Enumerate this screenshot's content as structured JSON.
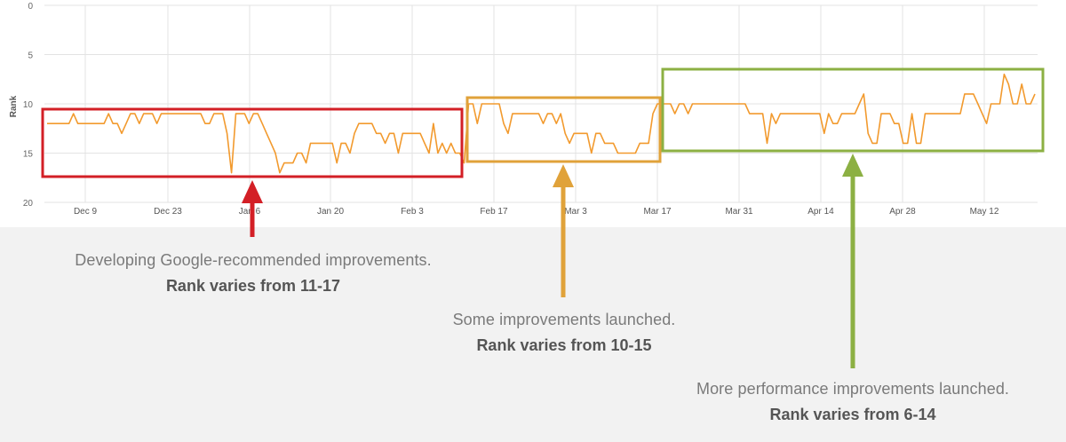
{
  "chart_data": {
    "type": "line",
    "ylabel": "Rank",
    "ylim": [
      0,
      20
    ],
    "y_inverted": true,
    "y_ticks": [
      0,
      5,
      10,
      15,
      20
    ],
    "x_tick_labels": [
      "Dec 9",
      "Dec 23",
      "Jan 6",
      "Jan 20",
      "Feb 3",
      "Feb 17",
      "Mar 3",
      "Mar 17",
      "Mar 31",
      "Apr 14",
      "Apr 28",
      "May 12"
    ],
    "x_range": [
      "Nov 28",
      "May 22"
    ],
    "grid": true,
    "line_color": "#f29a2e",
    "series": [
      {
        "values": [
          12,
          12,
          12,
          12,
          12,
          12,
          11,
          12,
          12,
          12,
          12,
          12,
          12,
          12,
          11,
          12,
          12,
          13,
          12,
          11,
          11,
          12,
          11,
          11,
          11,
          12,
          11,
          11,
          11,
          11,
          11,
          11,
          11,
          11,
          11,
          11,
          12,
          12,
          11,
          11,
          11,
          13,
          17,
          11,
          11,
          11,
          12,
          11,
          11,
          12,
          13,
          14,
          15,
          17,
          16,
          16,
          16,
          15,
          15,
          16,
          14,
          14,
          14,
          14,
          14,
          14,
          16,
          14,
          14,
          15,
          13,
          12,
          12,
          12,
          12,
          13,
          13,
          14,
          13,
          13,
          15,
          13,
          13,
          13,
          13,
          13,
          14,
          15,
          12,
          15,
          14,
          15,
          14,
          15,
          15,
          16,
          10,
          10,
          12,
          10,
          10,
          10,
          10,
          10,
          12,
          13,
          11,
          11,
          11,
          11,
          11,
          11,
          11,
          12,
          11,
          11,
          12,
          11,
          13,
          14,
          13,
          13,
          13,
          13,
          15,
          13,
          13,
          14,
          14,
          14,
          15,
          15,
          15,
          15,
          15,
          14,
          14,
          14,
          11,
          10,
          10,
          10,
          10,
          11,
          10,
          10,
          11,
          10,
          10,
          10,
          10,
          10,
          10,
          10,
          10,
          10,
          10,
          10,
          10,
          10,
          11,
          11,
          11,
          11,
          14,
          11,
          12,
          11,
          11,
          11,
          11,
          11,
          11,
          11,
          11,
          11,
          11,
          13,
          11,
          12,
          12,
          11,
          11,
          11,
          11,
          10,
          9,
          13,
          14,
          14,
          11,
          11,
          11,
          12,
          12,
          14,
          14,
          11,
          14,
          14,
          11,
          11,
          11,
          11,
          11,
          11,
          11,
          11,
          11,
          9,
          9,
          9,
          10,
          11,
          12,
          10,
          10,
          10,
          7,
          8,
          10,
          10,
          8,
          10,
          10,
          9
        ]
      }
    ],
    "boxes": [
      {
        "name": "period-1",
        "color": "#d31f26"
      },
      {
        "name": "period-2",
        "color": "#e0a23a"
      },
      {
        "name": "period-3",
        "color": "#8cb043"
      }
    ]
  },
  "annotations": [
    {
      "desc": "Developing Google-recommended improvements.",
      "range": "Rank varies from 11-17",
      "color": "#d31f26"
    },
    {
      "desc": "Some improvements launched.",
      "range": "Rank varies from 10-15",
      "color": "#e0a23a"
    },
    {
      "desc": "More performance improvements launched.",
      "range": "Rank varies from 6-14",
      "color": "#8cb043"
    }
  ]
}
